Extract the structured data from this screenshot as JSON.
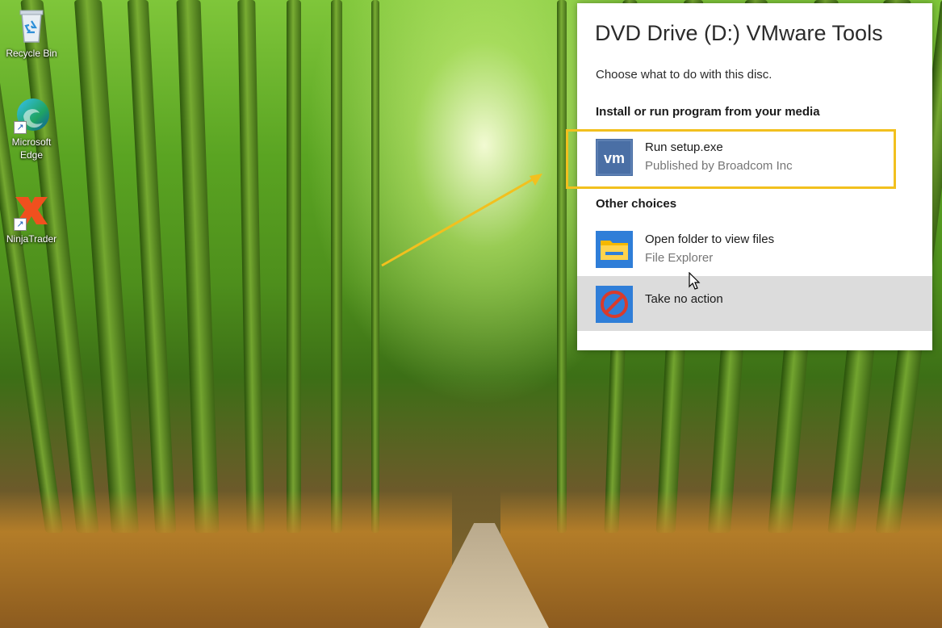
{
  "desktop": {
    "icons": [
      {
        "label": "Recycle Bin",
        "icon": "recycle-bin-icon"
      },
      {
        "label": "Microsoft Edge",
        "icon": "edge-icon"
      },
      {
        "label": "NinjaTrader",
        "icon": "ninjatrader-icon"
      }
    ]
  },
  "autoplay": {
    "title": "DVD Drive (D:) VMware Tools",
    "subtitle": "Choose what to do with this disc.",
    "section_install": "Install or run program from your media",
    "section_other": "Other choices",
    "options": [
      {
        "title": "Run setup.exe",
        "subtitle": "Published by Broadcom Inc",
        "icon": "vmware-icon"
      },
      {
        "title": "Open folder to view files",
        "subtitle": "File Explorer",
        "icon": "folder-icon"
      },
      {
        "title": "Take no action",
        "subtitle": "",
        "icon": "no-action-icon"
      }
    ]
  },
  "colors": {
    "annotation": "#f2c01e",
    "hover_row": "#dcdcdc",
    "vmware_icon_bg": "#4a6fa5",
    "no_action_red": "#d83b2b"
  }
}
